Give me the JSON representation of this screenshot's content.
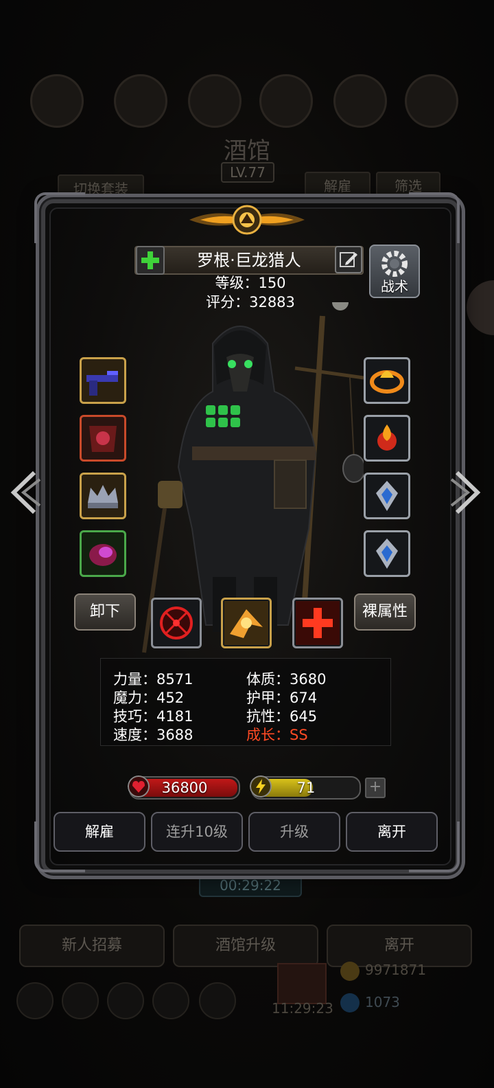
{
  "background": {
    "title": "酒馆",
    "level": "LV.77",
    "tabs": {
      "switch_outfit": "切换套装",
      "dismiss": "解雇",
      "filter": "筛选"
    },
    "timer": "00:29:22",
    "bottom_buttons": {
      "recruit": "新人招募",
      "tavern_upgrade": "酒馆升级",
      "leave": "离开"
    },
    "gold": "9971871",
    "gems": "1073",
    "clock": "11:29:23"
  },
  "hero": {
    "name": "罗根·巨龙猎人",
    "level_line": "等级：150",
    "score_line": "评分：32883",
    "tactics_label": "战术"
  },
  "equipment": {
    "left_slots": [
      {
        "icon": "pistol-icon",
        "frame": "gold"
      },
      {
        "icon": "armor-chest-icon",
        "frame": "red"
      },
      {
        "icon": "crown-icon",
        "frame": "gold"
      },
      {
        "icon": "gem-pendant-icon",
        "frame": "green"
      }
    ],
    "right_slots": [
      {
        "icon": "fire-ring-icon",
        "frame": "silver"
      },
      {
        "icon": "flame-orb-icon",
        "frame": "silver"
      },
      {
        "icon": "silver-emblem-icon",
        "frame": "silver"
      },
      {
        "icon": "silver-emblem-icon",
        "frame": "silver"
      }
    ]
  },
  "actions": {
    "unequip": "卸下",
    "bare_attributes": "裸属性"
  },
  "skills": [
    "target-skill-icon",
    "golden-strike-skill-icon",
    "heal-cross-skill-icon"
  ],
  "stats": {
    "strength": "力量：8571",
    "magic": "魔力：452",
    "skill": "技巧：4181",
    "speed": "速度：3688",
    "constitution": "体质：3680",
    "armor": "护甲：674",
    "resistance": "抗性：645",
    "growth": "成长：SS"
  },
  "vitals": {
    "hp": "36800",
    "energy": "71",
    "energy_fraction": 0.58,
    "add": "+"
  },
  "buttons": {
    "dismiss": "解雇",
    "level_up_10": "连升10级",
    "upgrade": "升级",
    "leave": "离开"
  },
  "colors": {
    "growth_text": "#ff4a24",
    "hp_fill": "#c01818",
    "energy_fill": "#d8c21a",
    "frame_gold": "#c9a14a"
  }
}
